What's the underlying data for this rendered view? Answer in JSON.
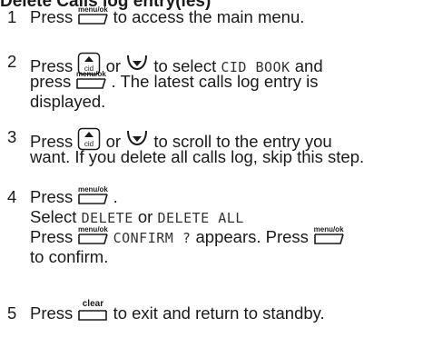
{
  "heading": "Delete Calls log entry(ies)",
  "keys": {
    "menu_ok": "menu/ok",
    "cid": "cid",
    "clear": "clear"
  },
  "icons": {
    "up_key": "up-cid-key-icon",
    "down_key": "down-arrow-key-icon",
    "menu_ok_key": "menu-ok-softkey-icon",
    "clear_key": "clear-softkey-icon"
  },
  "steps": [
    {
      "number": "1",
      "text_a": "Press",
      "text_b": "to access the main menu."
    },
    {
      "number": "2",
      "text_a": "Press",
      "text_b": "or",
      "text_c": "to select",
      "lcd_1": "CID BOOK",
      "text_d": "and",
      "text_e": "press",
      "text_f": ". The latest calls log entry is",
      "text_g": "displayed."
    },
    {
      "number": "3",
      "text_a": "Press",
      "text_b": "or",
      "text_c": "to scroll to the entry you",
      "text_d": "want. If you delete all calls log, skip this step."
    },
    {
      "number": "4",
      "text_a": "Press",
      "text_b": ".",
      "text_c": "Select",
      "lcd_1": "DELETE",
      "text_d": "or",
      "lcd_2": "DELETE ALL",
      "text_e": "Press",
      "lcd_3": "CONFIRM ?",
      "text_f": "appears. Press",
      "text_g": "to confirm."
    },
    {
      "number": "5",
      "text_a": "Press",
      "text_b": "to exit and return to standby."
    }
  ]
}
